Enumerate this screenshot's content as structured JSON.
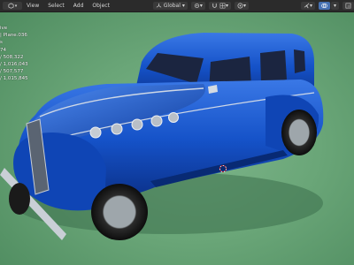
{
  "header": {
    "menu": [
      "View",
      "Select",
      "Add",
      "Object"
    ],
    "orientation": "Global"
  },
  "stats": {
    "lines": [
      "ive",
      "| Plane.036",
      "s",
      "",
      "74",
      "/ 508,322",
      "/ 1,016,043",
      "/ 507,577",
      "/ 1,015,845"
    ]
  },
  "colors": {
    "background": "#6aa678",
    "car_body": "#1452c9",
    "header": "#2b2b2b"
  }
}
